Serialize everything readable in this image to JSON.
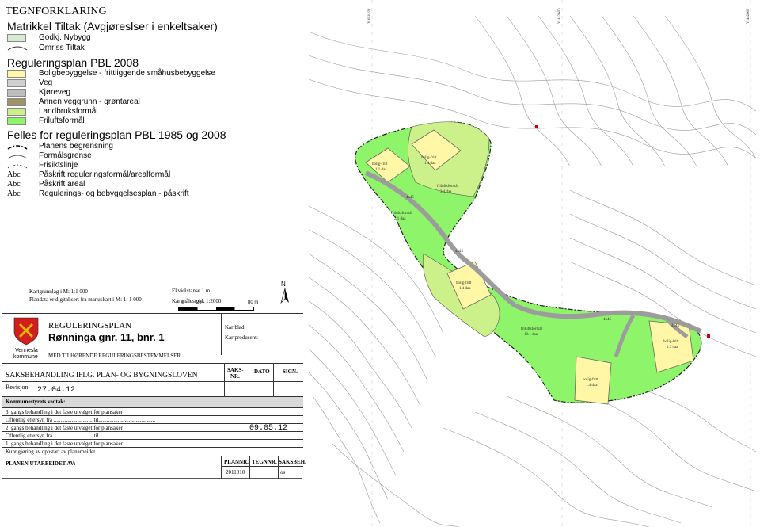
{
  "legend": {
    "title": "TEGNFORKLARING",
    "matrikkel": {
      "heading": "Matrikkel Tiltak (Avgjøreslser i enkeltsaker)",
      "items": [
        {
          "label": "Godkj. Nybygg",
          "color": "#d9ead3"
        },
        {
          "label": "Omriss Tiltak",
          "symbol": "line"
        }
      ]
    },
    "regplan": {
      "heading": "Reguleringsplan   PBL 2008",
      "items": [
        {
          "label": "Boligbebyggelse - frittliggende småhusbebyggelse",
          "color": "#fff7a6"
        },
        {
          "label": "Veg",
          "color": "#cfcfcf"
        },
        {
          "label": "Kjøreveg",
          "color": "#bdbdbd"
        },
        {
          "label": "Annen veggrunn - grøntareal",
          "color": "#9c9468"
        },
        {
          "label": "Landbruksformål",
          "color": "#ccf08a"
        },
        {
          "label": "Friluftsformål",
          "color": "#8ef56a"
        }
      ]
    },
    "felles": {
      "heading": "Felles for  reguleringsplan PBL 1985 og 2008",
      "items": [
        {
          "symbol": "boundary",
          "label": "Planens begrensning"
        },
        {
          "symbol": "line",
          "label": "Formålsgrense"
        },
        {
          "symbol": "line",
          "label": "Frisiktslinje"
        },
        {
          "symbol": "Abc",
          "label": "Påskrift reguleringsformål/arealformål"
        },
        {
          "symbol": "Abc",
          "label": "Påskrift areal"
        },
        {
          "symbol": "Abc",
          "label": "Regulerings- og bebyggelsesplan - påskrift"
        }
      ]
    }
  },
  "mapinfo": {
    "grunnlag": "Kartgrunnlag i M:  1:1 000",
    "plandata": "Plandata er digitalisert fra manuskart i M: 1: 1 000",
    "ekvidistanse": "Ekvidistanse   1            m",
    "malestokk": "Kartmålestokk 1:2000",
    "scale_zero": "0",
    "scale_mid": "20",
    "scale_end": "80 m",
    "north": "N"
  },
  "titleblock": {
    "kommune_1": "Vennesla",
    "kommune_2": "kommune",
    "heading": "REGULERINGSPLAN",
    "name": "Rønninga gnr. 11, bnr. 1",
    "kartblad": "Kartblad:",
    "kartprodusent": "Kartprodusent:",
    "bestemmelser": "MED TILHØRENDE REGULERINGSBESTEMMELSER",
    "saksbehandling": "SAKSBEHANDLING IFLG. PLAN- OG BYGNINGSLOVEN",
    "col_saks": "SAKS-",
    "col_nr": "NR.",
    "col_dato": "DATO",
    "col_sign": "SIGN.",
    "revisjon_label": "Revisjon",
    "revisjon_date": "27.04.12",
    "vedtak": "Kommunestyrets vedtak:",
    "rows": [
      "3. gangs behandling i det faste utvalget for plansaker",
      "Offentlig ettersyn fra .............................til.........................................",
      "2. gangs behandling i det faste utvalget for plansaker",
      "Offentlig ettersyn fra .............................til.........................................",
      "1. gangs behandling i det faste utvalget for plansaker",
      "Kunngjøring av oppstart av planarbeidet"
    ],
    "row_date": "09.05.12",
    "utarbeidet": "PLANEN UTARBEIDET AV:",
    "plannr_label": "PLANNR.",
    "tegnnr_label": "TEGNNR.",
    "saksbeh_label": "SAKSBEH.",
    "plannr": "2011010",
    "saksbeh": "os"
  },
  "map_labels": {
    "grid_1": "X 6502??",
    "grid_2": "Y 442600",
    "grid_3": "Y 44260?",
    "road_1": "4x45",
    "road_2": "4x45",
    "road_3": "4x45",
    "road_4": "4x45",
    "plot_1": "bolig-fritt",
    "plot_1b": "1.1 daa",
    "plot_2": "bolig-fritt",
    "plot_2b": "1.4 daa",
    "plot_3": "bolig-fritt",
    "plot_3b": "1.4 daa",
    "plot_4": "bolig-fritt",
    "plot_4b": "1.3 daa",
    "plot_5": "bolig-fritt",
    "plot_5b": "1.4 daa",
    "fri_1": "friluftsformål",
    "fri_1b": "3.4 daa",
    "fri_2": "friluftsformål",
    "fri_2b": "2.1 daa",
    "fri_3": "friluftsformål",
    "fri_3b": "10.1 daa"
  }
}
